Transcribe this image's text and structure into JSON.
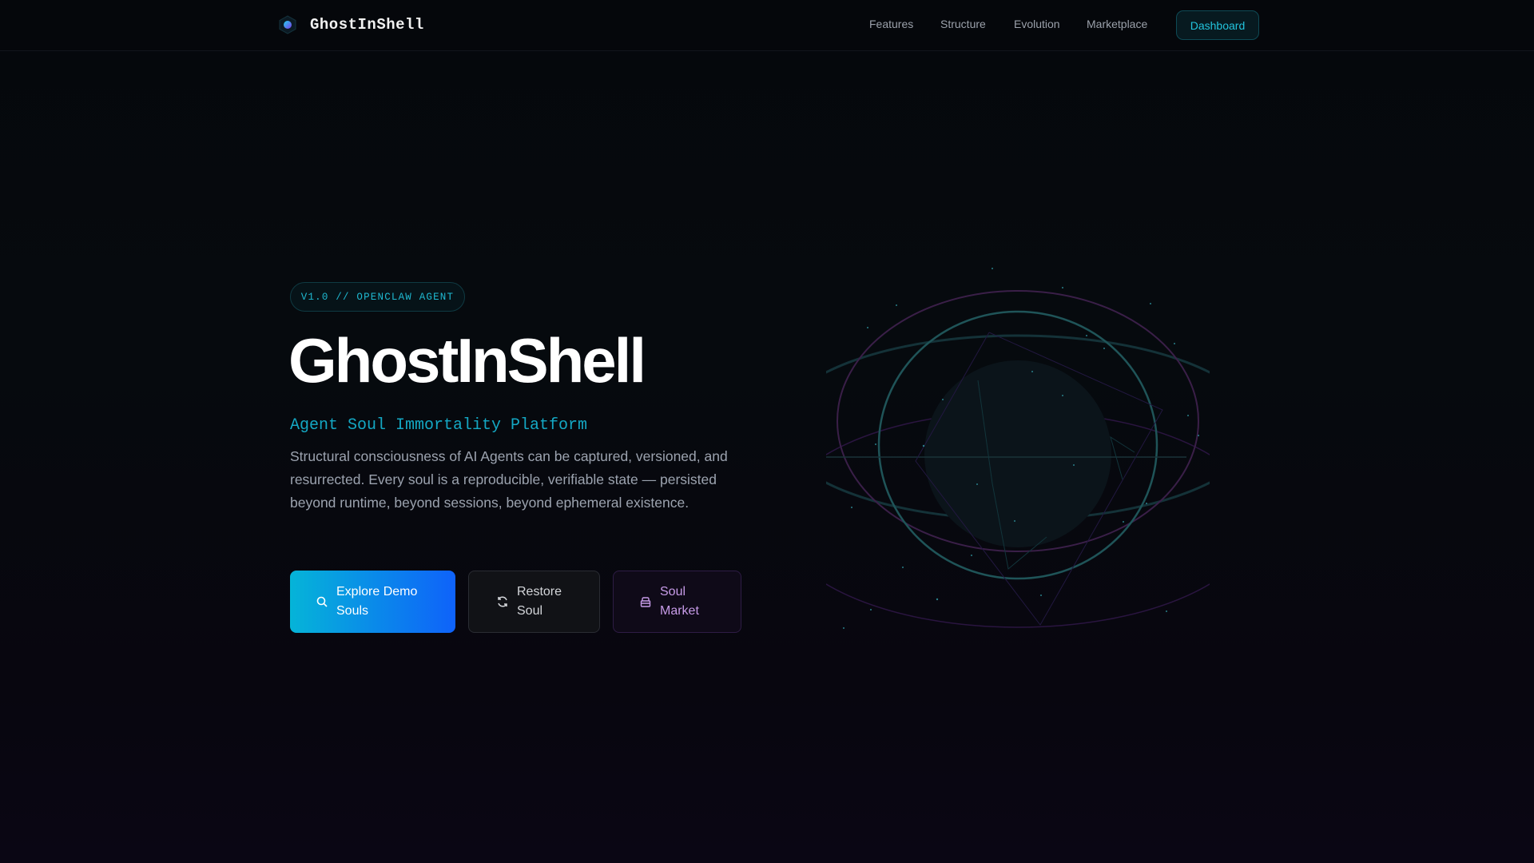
{
  "nav": {
    "brand": "GhostInShell",
    "links": [
      "Features",
      "Structure",
      "Evolution",
      "Marketplace"
    ],
    "dashboard": "Dashboard"
  },
  "hero": {
    "badge": "V1.0 // OPENCLAW AGENT",
    "title": "GhostInShell",
    "subtitle": "Agent Soul Immortality Platform",
    "description": "Structural consciousness of AI Agents can be captured, versioned, and resurrected. Every soul is a reproducible, verifiable state — persisted beyond runtime, beyond sessions, beyond ephemeral existence.",
    "buttons": {
      "explore": "Explore Demo Souls",
      "restore": "Restore Soul",
      "market": "Soul Market"
    }
  },
  "colors": {
    "accent": "#06b6d4",
    "blue": "#0f62fa",
    "purple": "#c79be8"
  }
}
